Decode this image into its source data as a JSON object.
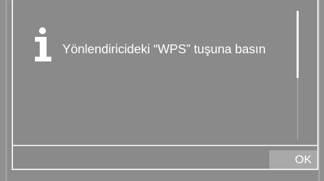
{
  "dialog": {
    "icon": "info-icon",
    "message": "Yönlendiricideki “WPS” tuşuna basın",
    "ok_label": "OK"
  },
  "colors": {
    "background": "#8a8a8a",
    "frame": "#ececec",
    "text": "#ffffff",
    "button_bg": "#a9a9a9"
  }
}
